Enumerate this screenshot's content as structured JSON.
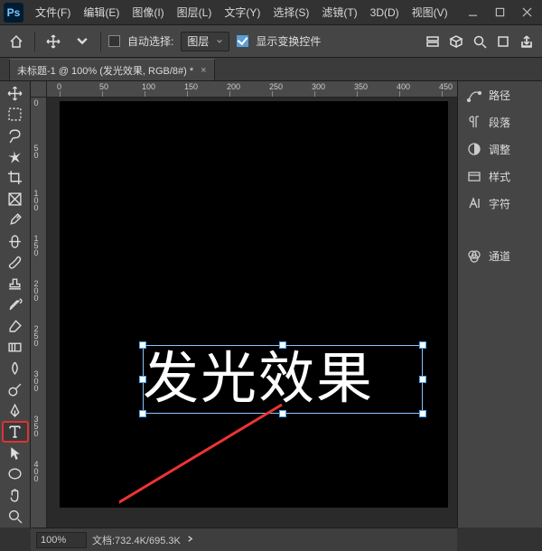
{
  "app_logo": "Ps",
  "menu": [
    "文件(F)",
    "编辑(E)",
    "图像(I)",
    "图层(L)",
    "文字(Y)",
    "选择(S)",
    "滤镜(T)",
    "3D(D)",
    "视图(V)"
  ],
  "options": {
    "auto_select": "自动选择:",
    "dropdown_value": "图层",
    "show_transform": "显示变换控件"
  },
  "doc_tab": {
    "title": "未标题-1 @ 100% (发光效果, RGB/8#) *"
  },
  "canvas_text": "发光效果",
  "panels": [
    "路径",
    "段落",
    "调整",
    "样式",
    "字符",
    "通道"
  ],
  "status": {
    "zoom": "100%",
    "doc": "文档:732.4K/695.3K"
  },
  "ruler_h": [
    "0",
    "50",
    "100",
    "150",
    "200",
    "250",
    "300",
    "350",
    "400",
    "450"
  ],
  "ruler_v": [
    "0",
    "50",
    "100",
    "150",
    "200",
    "250",
    "300",
    "350",
    "400"
  ]
}
